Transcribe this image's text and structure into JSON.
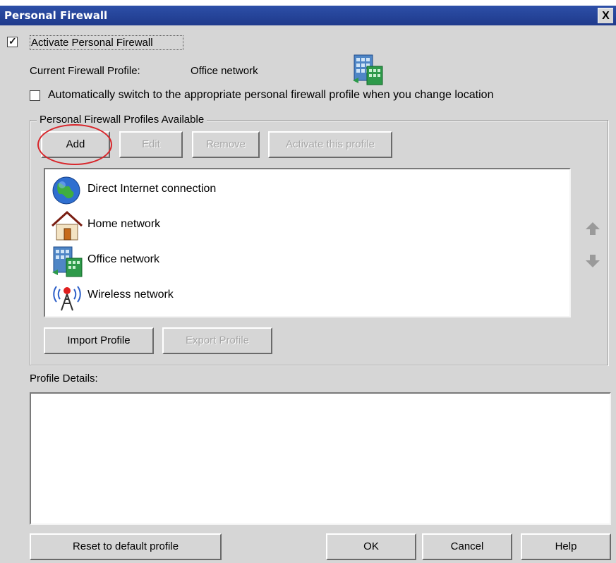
{
  "window": {
    "title": "Personal Firewall",
    "close_glyph": "X"
  },
  "activate": {
    "label": "Activate Personal Firewall",
    "checked": true
  },
  "current_profile": {
    "label": "Current Firewall Profile:",
    "value": "Office network",
    "icon": "office-building-icon"
  },
  "auto_switch": {
    "label": "Automatically switch to the appropriate personal firewall profile when you change location",
    "checked": false
  },
  "profiles_group": {
    "title": "Personal Firewall Profiles Available",
    "buttons": {
      "add": "Add",
      "edit": "Edit",
      "remove": "Remove",
      "activate": "Activate this profile"
    },
    "items": [
      {
        "label": "Direct Internet connection",
        "icon": "globe-icon"
      },
      {
        "label": "Home network",
        "icon": "house-icon"
      },
      {
        "label": "Office network",
        "icon": "office-building-icon"
      },
      {
        "label": "Wireless network",
        "icon": "wireless-tower-icon"
      }
    ],
    "import_label": "Import Profile",
    "export_label": "Export Profile"
  },
  "details": {
    "label": "Profile Details:",
    "content": ""
  },
  "footer": {
    "reset_label": "Reset to default profile",
    "ok_label": "OK",
    "cancel_label": "Cancel",
    "help_label": "Help"
  },
  "colors": {
    "titlebar": "#1f3a8c",
    "panel": "#d6d6d6",
    "annotation": "#d8262b"
  }
}
